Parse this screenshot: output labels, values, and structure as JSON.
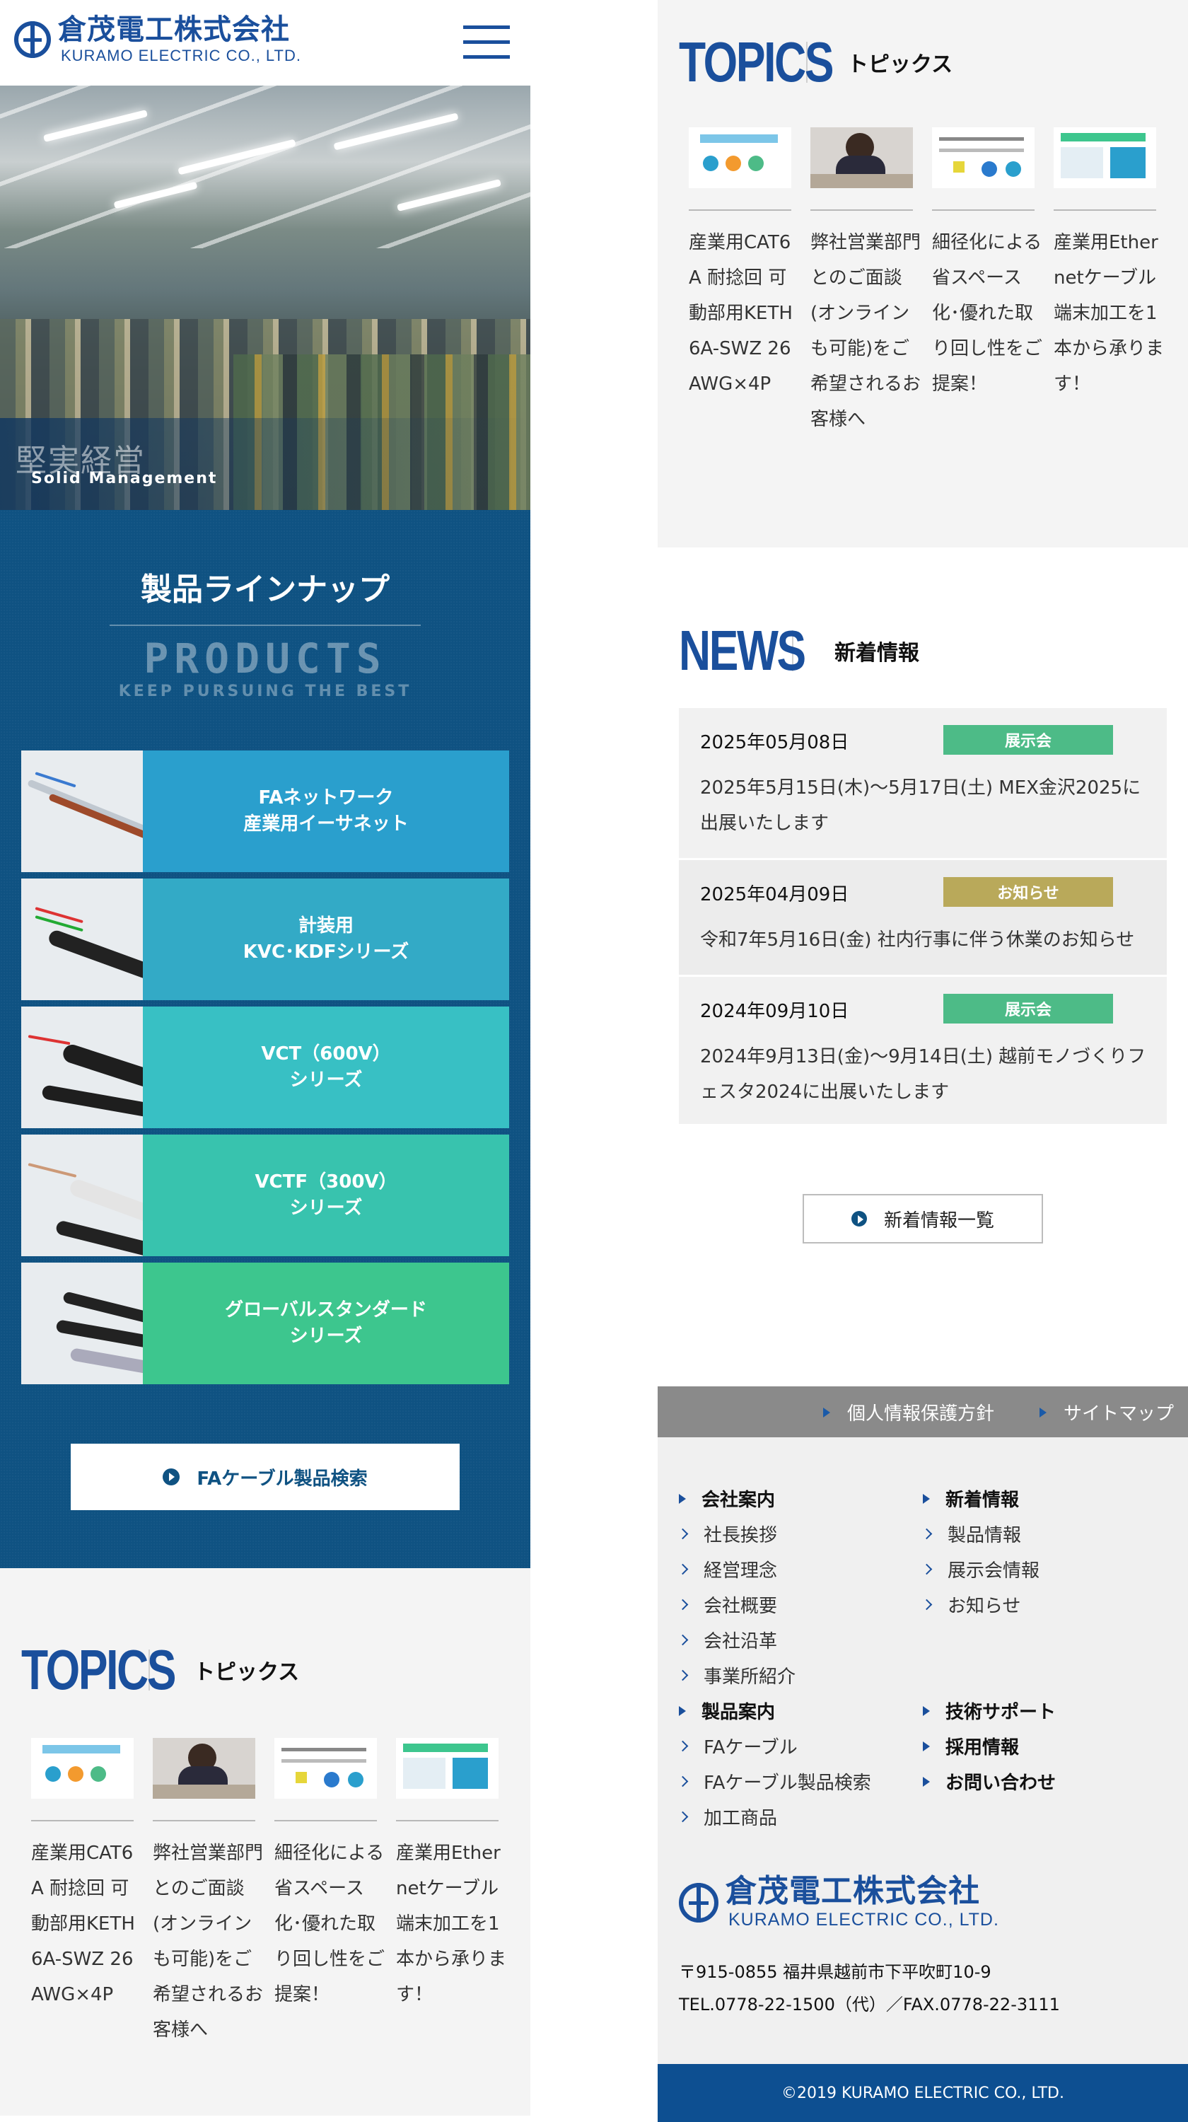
{
  "header": {
    "logo_jp": "倉茂電工株式会社",
    "logo_en": "KURAMO ELECTRIC CO., LTD."
  },
  "hero": {
    "caption_jp": "堅実経営",
    "caption_en": "Solid Management"
  },
  "products": {
    "heading": "製品ラインナップ",
    "heading_en": "PRODUCTS",
    "tagline": "KEEP PURSUING THE BEST",
    "items": [
      {
        "line1": "FAネットワーク",
        "line2": "産業用イーサネット",
        "color": "#2a9fcd"
      },
      {
        "line1": "計装用",
        "line2": "KVC･KDFシリーズ",
        "color": "#33aac6"
      },
      {
        "line1": "VCT（600V）",
        "line2": "シリーズ",
        "color": "#38c0c4"
      },
      {
        "line1": "VCTF（300V）",
        "line2": "シリーズ",
        "color": "#38c3ae"
      },
      {
        "line1": "グローバルスタンダード",
        "line2": "シリーズ",
        "color": "#3dc68e"
      }
    ],
    "search_label": "FAケーブル製品検索"
  },
  "topics": {
    "title_en": "TOPICS",
    "title_jp": "トピックス",
    "items": [
      {
        "text": "産業用CAT6A 耐捻回 可動部用KETH6A-SWZ 26AWG×4P"
      },
      {
        "text": "弊社営業部門とのご面談(オンラインも可能)をご希望されるお客様へ"
      },
      {
        "text": "細径化による省スペース化･優れた取り回し性をご提案！"
      },
      {
        "text": "産業用Ethernetケーブル端末加工を1本から承ります！"
      }
    ]
  },
  "news": {
    "title_en": "NEWS",
    "title_jp": "新着情報",
    "items": [
      {
        "date": "2025年05月08日",
        "tag": "展示会",
        "tag_color": "#4dbb87",
        "body": "2025年5月15日(木)～5月17日(土) MEX金沢2025に出展いたします"
      },
      {
        "date": "2025年04月09日",
        "tag": "お知らせ",
        "tag_color": "#b9a95a",
        "body": "令和7年5月16日(金) 社内行事に伴う休業のお知らせ"
      },
      {
        "date": "2024年09月10日",
        "tag": "展示会",
        "tag_color": "#4dbb87",
        "body": "2024年9月13日(金)～9月14日(土) 越前モノづくりフェスタ2024に出展いたします"
      }
    ],
    "more_label": "新着情報一覧"
  },
  "footer": {
    "privacy": "個人情報保護方針",
    "sitemap": "サイトマップ",
    "col1": [
      {
        "label": "会社案内",
        "bold": true
      },
      {
        "label": "社長挨拶",
        "bold": false
      },
      {
        "label": "経営理念",
        "bold": false
      },
      {
        "label": "会社概要",
        "bold": false
      },
      {
        "label": "会社沿革",
        "bold": false
      },
      {
        "label": "事業所紹介",
        "bold": false
      },
      {
        "label": "製品案内",
        "bold": true
      },
      {
        "label": "FAケーブル",
        "bold": false
      },
      {
        "label": "FAケーブル製品検索",
        "bold": false
      },
      {
        "label": "加工商品",
        "bold": false
      }
    ],
    "col2": [
      {
        "label": "新着情報",
        "bold": true
      },
      {
        "label": "製品情報",
        "bold": false
      },
      {
        "label": "展示会情報",
        "bold": false
      },
      {
        "label": "お知らせ",
        "bold": false
      },
      {
        "label": "技術サポート",
        "bold": true
      },
      {
        "label": "採用情報",
        "bold": true
      },
      {
        "label": "お問い合わせ",
        "bold": true
      }
    ],
    "address": "〒915-0855 福井県越前市下平吹町10-9",
    "tel": "TEL.0778-22-1500（代）／FAX.0778-22-3111",
    "copyright": "©2019 KURAMO ELECTRIC CO., LTD."
  }
}
